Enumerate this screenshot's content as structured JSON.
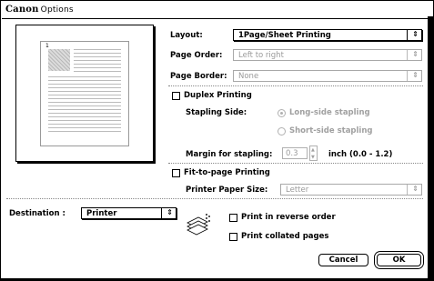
{
  "window": {
    "brand": "Canon",
    "title": "Options"
  },
  "layout": {
    "label": "Layout:",
    "value": "1Page/Sheet Printing"
  },
  "page_order": {
    "label": "Page Order:",
    "value": "Left to right"
  },
  "page_border": {
    "label": "Page Border:",
    "value": "None"
  },
  "duplex": {
    "label": "Duplex Printing",
    "stapling_side_label": "Stapling Side:",
    "options": [
      "Long-side stapling",
      "Short-side stapling"
    ],
    "selected": "Long-side stapling",
    "margin_label": "Margin for stapling:",
    "margin_value": "0.3",
    "margin_unit": "inch (0.0 - 1.2)"
  },
  "fit_to_page": {
    "label": "Fit-to-page Printing",
    "paper_size_label": "Printer Paper Size:",
    "paper_size_value": "Letter"
  },
  "destination": {
    "label": "Destination :",
    "value": "Printer"
  },
  "options": {
    "reverse_order": "Print in reverse order",
    "collated": "Print collated pages"
  },
  "buttons": {
    "cancel": "Cancel",
    "ok": "OK"
  },
  "preview": {
    "page_number": "1"
  }
}
